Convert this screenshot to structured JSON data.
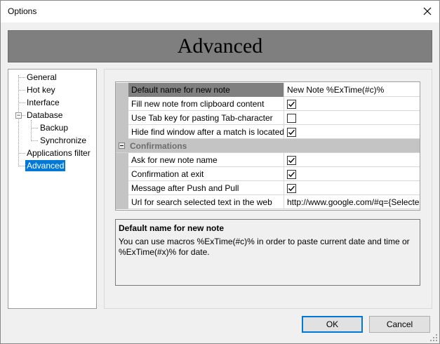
{
  "window": {
    "title": "Options"
  },
  "header": {
    "title": "Advanced"
  },
  "tree": {
    "items": [
      {
        "label": "General"
      },
      {
        "label": "Hot key"
      },
      {
        "label": "Interface"
      },
      {
        "label": "Database"
      },
      {
        "label": "Backup"
      },
      {
        "label": "Synchronize"
      },
      {
        "label": "Applications filter"
      },
      {
        "label": "Advanced"
      }
    ]
  },
  "grid": {
    "rows": [
      {
        "name": "Default name for new note",
        "value": "New Note %ExTime(#c)%"
      },
      {
        "name": "Fill new note from clipboard content",
        "checked": true
      },
      {
        "name": "Use Tab key for pasting Tab-character",
        "checked": false
      },
      {
        "name": "Hide find window after a match is located",
        "checked": true
      },
      {
        "category": "Confirmations"
      },
      {
        "name": "Ask for new note name",
        "checked": true
      },
      {
        "name": "Confirmation at exit",
        "checked": true
      },
      {
        "name": "Message after Push and Pull",
        "checked": true
      },
      {
        "name": "Url for search selected text in the web",
        "value": "http://www.google.com/#q={Selected text}"
      }
    ]
  },
  "description": {
    "title": "Default name for new note",
    "text": "You can use macros %ExTime(#c)% in order to paste current date and time or %ExTime(#x)% for date."
  },
  "buttons": {
    "ok": "OK",
    "cancel": "Cancel"
  },
  "colors": {
    "selection": "#0078d7",
    "banner": "#7f7f7f",
    "gutter": "#c4c4c4"
  }
}
